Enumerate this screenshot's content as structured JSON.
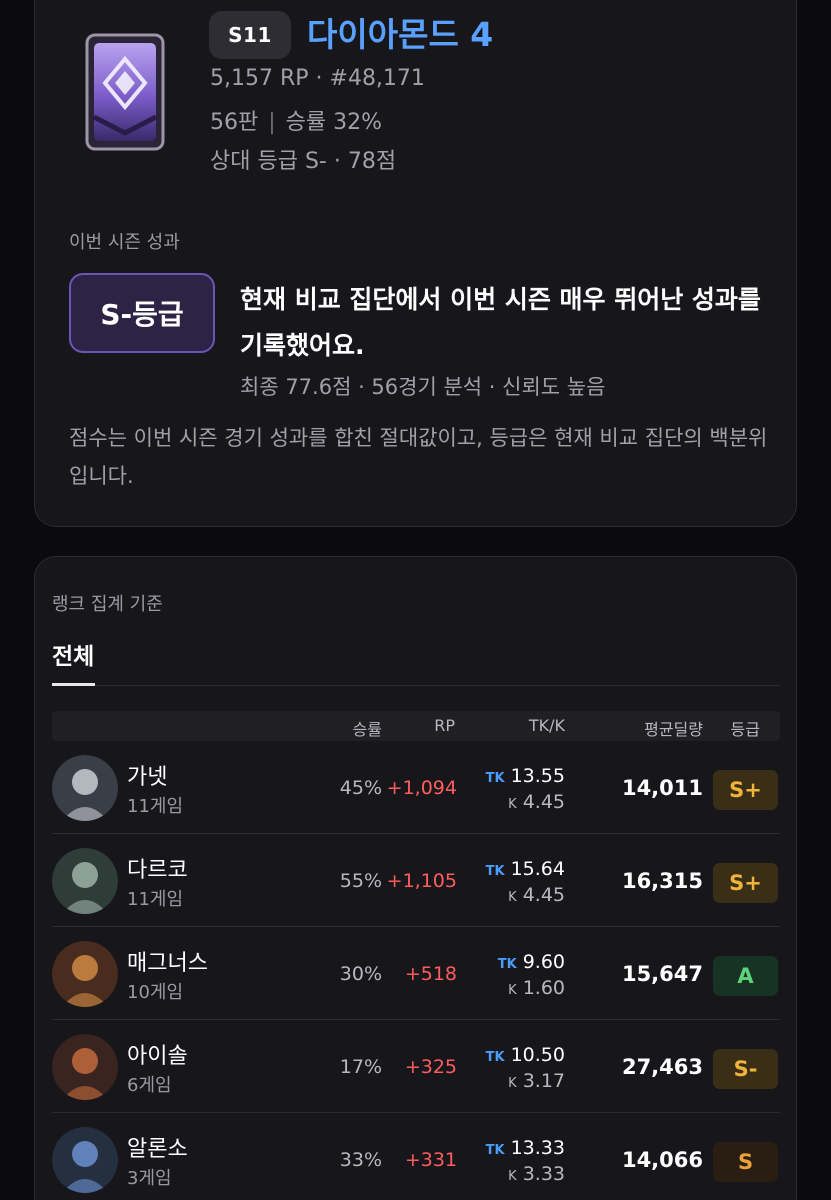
{
  "profile": {
    "season": "S11",
    "tier": "다이아몬드 4",
    "rp_line": "5,157 RP · #48,171",
    "games": "56판",
    "winrate": "승률 32%",
    "relative": "상대 등급 S- · 78점"
  },
  "season_perf": {
    "label": "이번 시즌 성과",
    "grade": "S-등급",
    "headline": "현재 비교 집단에서 이번 시즌 매우 뛰어난 성과를 기록했어요.",
    "detail": "최종 77.6점 · 56경기 분석 · 신뢰도 높음",
    "note": "점수는 이번 시즌 경기 성과를 합친 절대값이고, 등급은 현재 비교 집단의 백분위입니다."
  },
  "rank_stats": {
    "label": "랭크 집계 기준",
    "tab": "전체",
    "headers": {
      "winrate": "승률",
      "rp": "RP",
      "tkk": "TK/K",
      "dmg": "평균딜량",
      "grade": "등급"
    },
    "tk_tag": "TK",
    "k_tag": "K",
    "rows": [
      {
        "name": "가넷",
        "games": "11게임",
        "winrate": "45%",
        "rp": "+1,094",
        "tk": "13.55",
        "k": "4.45",
        "dmg": "14,011",
        "grade": "S+",
        "avatar_icon": "garnet-portrait"
      },
      {
        "name": "다르코",
        "games": "11게임",
        "winrate": "55%",
        "rp": "+1,105",
        "tk": "15.64",
        "k": "4.45",
        "dmg": "16,315",
        "grade": "S+",
        "avatar_icon": "darko-portrait"
      },
      {
        "name": "매그너스",
        "games": "10게임",
        "winrate": "30%",
        "rp": "+518",
        "tk": "9.60",
        "k": "1.60",
        "dmg": "15,647",
        "grade": "A",
        "avatar_icon": "magnus-portrait"
      },
      {
        "name": "아이솔",
        "games": "6게임",
        "winrate": "17%",
        "rp": "+325",
        "tk": "10.50",
        "k": "3.17",
        "dmg": "27,463",
        "grade": "S-",
        "avatar_icon": "isol-portrait"
      },
      {
        "name": "알론소",
        "games": "3게임",
        "winrate": "33%",
        "rp": "+331",
        "tk": "13.33",
        "k": "3.33",
        "dmg": "14,066",
        "grade": "S",
        "avatar_icon": "alonso-portrait"
      }
    ]
  },
  "colors": {
    "tier": "#5aa0ff",
    "rp_positive": "#ff5d5d",
    "tk_tag": "#4a9cff",
    "grade_gold_text": "#f0b43c",
    "grade_gold_bg": "#3a2e16",
    "grade_green_text": "#5fd37a",
    "grade_green_bg": "#173323",
    "grade_s_text": "#e9a23b",
    "grade_s_bg": "#2a1d12",
    "grade_box_bg": "#2c2345",
    "grade_box_border": "#6b55b7"
  }
}
